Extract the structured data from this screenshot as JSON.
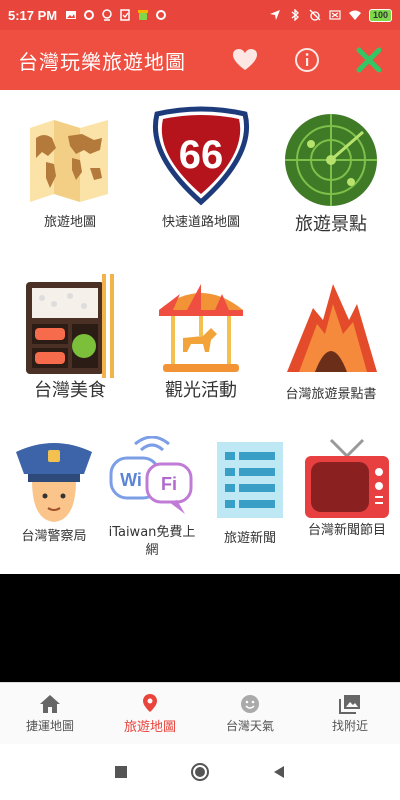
{
  "status_bar": {
    "time": "5:17 PM",
    "battery": "100",
    "icons_left": [
      "photo-icon",
      "record-icon",
      "location-pin-icon",
      "clipboard-icon",
      "android-icon",
      "record-icon"
    ],
    "icons_right": [
      "navigation-icon",
      "bluetooth-icon",
      "alarm-off-icon",
      "mute-icon",
      "wifi-icon",
      "battery-icon"
    ]
  },
  "app_bar": {
    "title": "台灣玩樂旅遊地圖",
    "actions": [
      "heart-icon",
      "info-icon",
      "close-icon"
    ],
    "accent": "#ef4f41"
  },
  "tiles": [
    {
      "label": "旅遊地圖",
      "icon": "world-map-icon"
    },
    {
      "label": "快速道路地圖",
      "icon": "highway-66-icon"
    },
    {
      "label": "旅遊景點",
      "icon": "radar-icon"
    },
    {
      "label": "台灣美食",
      "icon": "bento-icon"
    },
    {
      "label": "觀光活動",
      "icon": "carousel-icon"
    },
    {
      "label": "台灣旅遊景點書",
      "icon": "volcano-icon"
    },
    {
      "label": "台灣警察局",
      "icon": "police-icon"
    },
    {
      "label": "iTaiwan免費上網",
      "icon": "wifi-bubble-icon",
      "wifi_text_1": "Wi",
      "wifi_text_2": "Fi"
    },
    {
      "label": "旅遊新聞",
      "icon": "news-list-icon"
    },
    {
      "label": "台灣新聞節目",
      "icon": "television-icon"
    }
  ],
  "highway_number": "66",
  "bottom_nav": [
    {
      "label": "捷運地圖",
      "icon": "home-icon",
      "active": false
    },
    {
      "label": "旅遊地圖",
      "icon": "map-pin-icon",
      "active": true
    },
    {
      "label": "台灣天氣",
      "icon": "smiley-icon",
      "active": false
    },
    {
      "label": "找附近",
      "icon": "gallery-icon",
      "active": false
    }
  ],
  "system_nav": [
    "recents-icon",
    "home-circle-icon",
    "back-icon"
  ]
}
